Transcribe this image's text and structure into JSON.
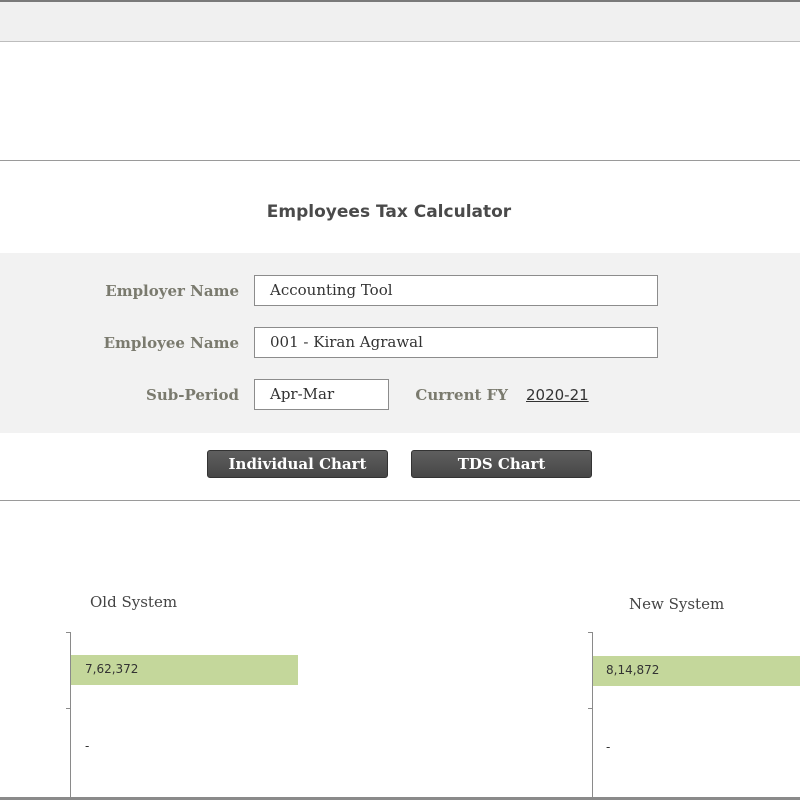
{
  "title": "Employees Tax Calculator",
  "form": {
    "employer_label": "Employer Name",
    "employer_value": "Accounting Tool",
    "employee_label": "Employee Name",
    "employee_value": "001 - Kiran Agrawal",
    "subperiod_label": "Sub-Period",
    "subperiod_value": "Apr-Mar",
    "fy_label": "Current FY",
    "fy_value": "2020-21"
  },
  "buttons": {
    "individual_chart": "Individual  Chart",
    "tds_chart": "TDS Chart"
  },
  "colors": {
    "bar": "#c4d79b",
    "button": "#4f4f4f",
    "panel": "#f2f2f2"
  },
  "chart_data": [
    {
      "type": "bar",
      "title": "Old System",
      "categories": [
        "",
        ""
      ],
      "values": [
        762372,
        0
      ],
      "data_labels": [
        "7,62,372",
        "-"
      ]
    },
    {
      "type": "bar",
      "title": "New System",
      "categories": [
        "",
        ""
      ],
      "values": [
        814872,
        0
      ],
      "data_labels": [
        "8,14,872",
        "-"
      ]
    }
  ]
}
